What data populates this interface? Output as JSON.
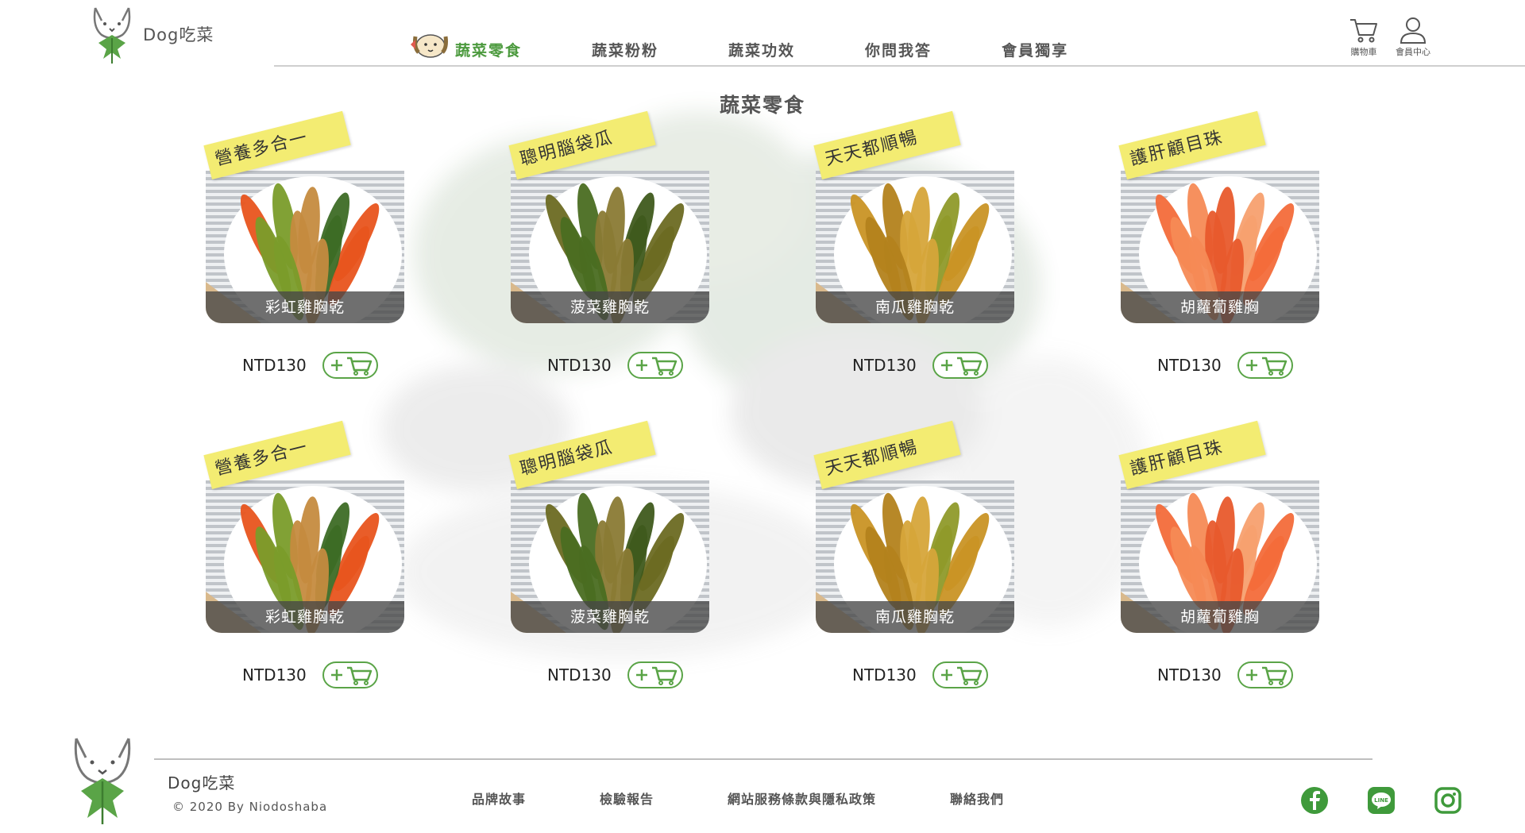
{
  "brand": {
    "name": "Dog吃菜"
  },
  "nav": {
    "items": [
      {
        "label": "蔬菜零食",
        "active": true
      },
      {
        "label": "蔬菜粉粉"
      },
      {
        "label": "蔬菜功效"
      },
      {
        "label": "你問我答"
      },
      {
        "label": "會員獨享"
      }
    ]
  },
  "header_icons": {
    "cart_label": "購物車",
    "member_label": "會員中心"
  },
  "page": {
    "title": "蔬菜零食"
  },
  "products": [
    {
      "tag": "營養多合一",
      "name": "彩虹雞胸乾",
      "price": "NTD130",
      "variant": "rainbow"
    },
    {
      "tag": "聰明腦袋瓜",
      "name": "菠菜雞胸乾",
      "price": "NTD130",
      "variant": "spinach"
    },
    {
      "tag": "天天都順暢",
      "name": "南瓜雞胸乾",
      "price": "NTD130",
      "variant": "pumpkin"
    },
    {
      "tag": "護肝顧目珠",
      "name": "胡蘿蔔雞胸",
      "price": "NTD130",
      "variant": "carrot"
    },
    {
      "tag": "營養多合一",
      "name": "彩虹雞胸乾",
      "price": "NTD130",
      "variant": "rainbow"
    },
    {
      "tag": "聰明腦袋瓜",
      "name": "菠菜雞胸乾",
      "price": "NTD130",
      "variant": "spinach"
    },
    {
      "tag": "天天都順暢",
      "name": "南瓜雞胸乾",
      "price": "NTD130",
      "variant": "pumpkin"
    },
    {
      "tag": "護肝顧目珠",
      "name": "胡蘿蔔雞胸",
      "price": "NTD130",
      "variant": "carrot"
    }
  ],
  "footer": {
    "brand": "Dog吃菜",
    "copyright": "© 2020 By Niodoshaba",
    "links": [
      "品牌故事",
      "檢驗報告",
      "網站服務條款與隱私政策",
      "聯絡我們"
    ],
    "social": [
      "facebook-icon",
      "line-icon",
      "instagram-icon"
    ]
  },
  "colors": {
    "accent": "#4c9a3e",
    "tag": "#f3ec72",
    "social": "#3f9a3b"
  }
}
